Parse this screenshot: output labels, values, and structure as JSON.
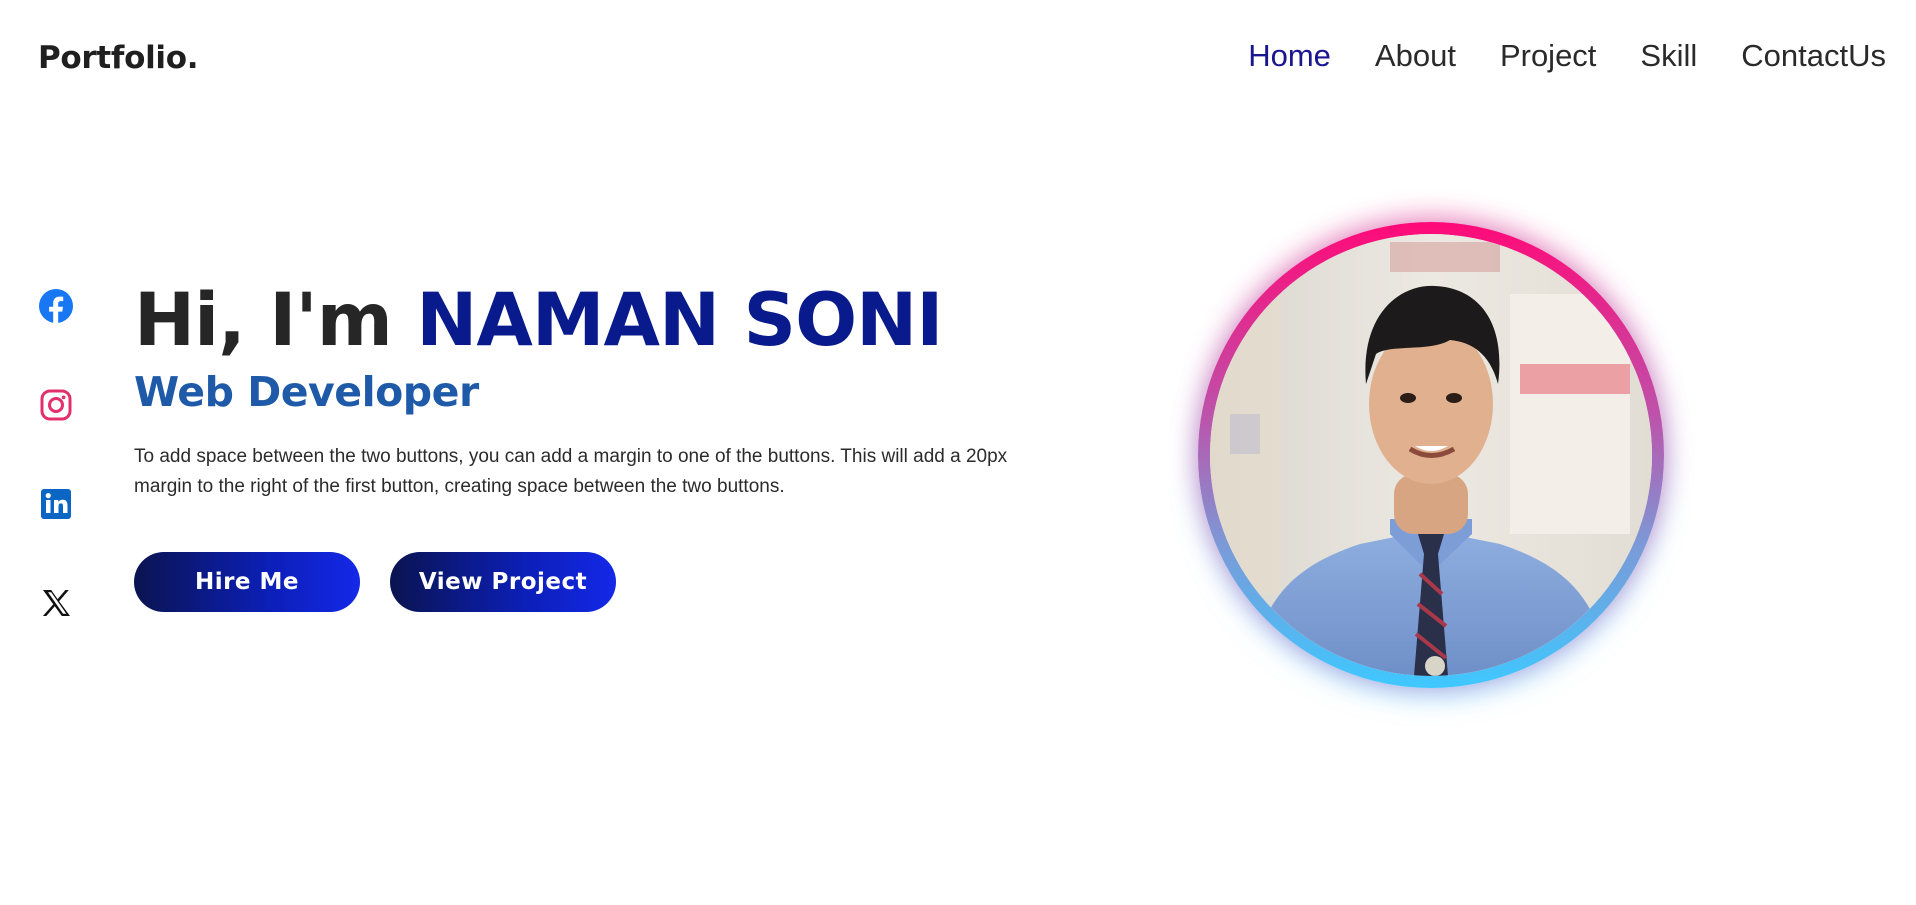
{
  "header": {
    "logo": "Portfolio.",
    "nav": [
      {
        "label": "Home",
        "active": true
      },
      {
        "label": "About"
      },
      {
        "label": "Project"
      },
      {
        "label": "Skill"
      },
      {
        "label": "ContactUs"
      }
    ]
  },
  "socials": [
    {
      "icon": "facebook-icon",
      "color": "#1877f2"
    },
    {
      "icon": "instagram-icon",
      "color": "#e1306c"
    },
    {
      "icon": "linkedin-icon",
      "color": "#0a66c2"
    },
    {
      "icon": "x-icon",
      "color": "#111111"
    }
  ],
  "hero": {
    "greeting": "Hi, I'm",
    "name": "NAMAN SONI",
    "role": "Web Developer",
    "description": "To add space between the two buttons, you can add a margin to one of the buttons. This will add a 20px margin to the right of the first button, creating space between the two buttons.",
    "hire_label": "Hire Me",
    "project_label": "View Project"
  },
  "colors": {
    "accent": "#081a8c",
    "role": "#1e5aa8",
    "active_nav": "#1a1590"
  }
}
